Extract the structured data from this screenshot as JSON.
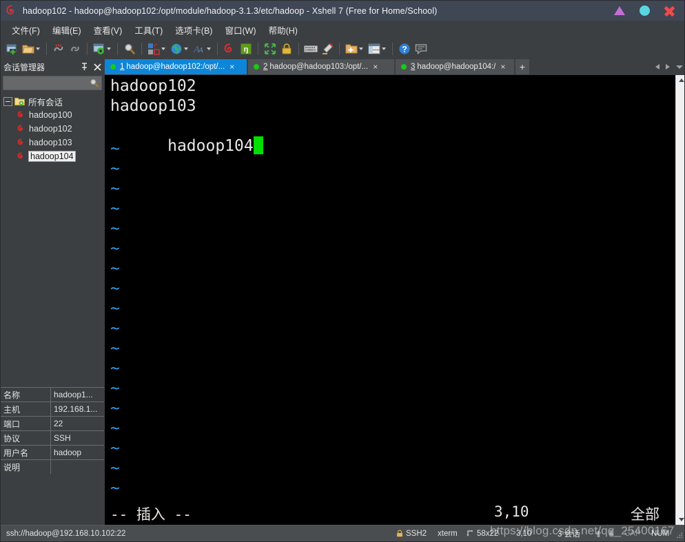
{
  "window": {
    "title": "hadoop102 - hadoop@hadoop102:/opt/module/hadoop-3.1.3/etc/hadoop - Xshell 7 (Free for Home/School)",
    "app_icon": "xshell-spiral-icon",
    "minimize_label": "▲",
    "maximize_label": "●",
    "close_label": "✕"
  },
  "menubar": {
    "items": [
      {
        "label": "文件(F)"
      },
      {
        "label": "编辑(E)"
      },
      {
        "label": "查看(V)"
      },
      {
        "label": "工具(T)"
      },
      {
        "label": "选项卡(B)"
      },
      {
        "label": "窗口(W)"
      },
      {
        "label": "帮助(H)"
      }
    ]
  },
  "toolbar": {
    "items": [
      {
        "name": "new-session-icon",
        "dropdown": false
      },
      {
        "name": "open-folder-icon",
        "dropdown": true
      },
      {
        "name": "disconnect-icon",
        "dropdown": false
      },
      {
        "name": "reconnect-icon",
        "dropdown": false
      },
      {
        "name": "session-properties-icon",
        "dropdown": true
      },
      {
        "name": "find-icon",
        "dropdown": false
      },
      {
        "name": "layout-icon",
        "dropdown": true
      },
      {
        "name": "globe-icon",
        "dropdown": true
      },
      {
        "name": "font-icon",
        "dropdown": true
      },
      {
        "name": "xshell-icon",
        "dropdown": false
      },
      {
        "name": "xftp-icon",
        "dropdown": false
      },
      {
        "name": "fullscreen-icon",
        "dropdown": false
      },
      {
        "name": "lock-icon",
        "dropdown": false
      },
      {
        "name": "keyboard-icon",
        "dropdown": false
      },
      {
        "name": "highlight-pen-icon",
        "dropdown": false
      },
      {
        "name": "new-folder-icon",
        "dropdown": true
      },
      {
        "name": "split-view-icon",
        "dropdown": true
      },
      {
        "name": "help-icon",
        "dropdown": false
      },
      {
        "name": "comment-icon",
        "dropdown": false
      }
    ]
  },
  "sidebar": {
    "title": "会话管理器",
    "pin_icon": "pin-icon",
    "close_icon": "close-icon",
    "search_placeholder": "",
    "search_icon": "search-icon",
    "root": {
      "label": "所有会话",
      "icon": "folder-sessions-icon"
    },
    "sessions": [
      {
        "label": "hadoop100",
        "icon": "xshell-session-icon",
        "selected": false
      },
      {
        "label": "hadoop102",
        "icon": "xshell-session-icon",
        "selected": false
      },
      {
        "label": "hadoop103",
        "icon": "xshell-session-icon",
        "selected": false
      },
      {
        "label": "hadoop104",
        "icon": "xshell-session-icon",
        "selected": true
      }
    ]
  },
  "properties": {
    "rows": [
      {
        "key": "名称",
        "value": "hadoop1..."
      },
      {
        "key": "主机",
        "value": "192.168.1..."
      },
      {
        "key": "端口",
        "value": "22"
      },
      {
        "key": "协议",
        "value": "SSH"
      },
      {
        "key": "用户名",
        "value": "hadoop"
      },
      {
        "key": "说明",
        "value": ""
      }
    ]
  },
  "tabs": {
    "items": [
      {
        "num": "1",
        "label": "hadoop@hadoop102:/opt/...",
        "active": true,
        "close": "×",
        "status": "connected"
      },
      {
        "num": "2",
        "label": "hadoop@hadoop103:/opt/...",
        "active": false,
        "close": "×",
        "status": "connected"
      },
      {
        "num": "3",
        "label": "hadoop@hadoop104:/",
        "active": false,
        "close": "×",
        "status": "connected"
      }
    ],
    "add_label": "+",
    "nav_prev": "prev-tab-arrow-icon",
    "nav_next": "next-tab-arrow-icon",
    "nav_list": "tab-list-dropdown-icon"
  },
  "terminal": {
    "lines": [
      "hadoop102",
      "hadoop103",
      "hadoop104"
    ],
    "cursor_line": 2,
    "tilde_char": "~",
    "tilde_count": 19,
    "colors": {
      "background": "#000000",
      "foreground": "#e8e8e8",
      "tilde": "#2f9fe8",
      "cursor": "#00e000"
    },
    "vim_status": {
      "mode": "-- 插入 --",
      "position": "3,10",
      "scroll": "全部"
    }
  },
  "statusbar": {
    "connection": "ssh://hadoop@192.168.10.102:22",
    "security": "SSH2",
    "security_icon": "lock-icon",
    "term_type": "xterm",
    "size_icon": "resize-icon",
    "size": "58x22",
    "cursor": "3,10",
    "sessions": "3 会话",
    "upload_icon": "upload-arrow-icon",
    "download_icon": "download-arrow-icon",
    "caps": "CAP",
    "num": "NUM",
    "grip_icon": "resize-grip-icon"
  },
  "watermark": "https://blog.csdn.net/qq_25400167"
}
